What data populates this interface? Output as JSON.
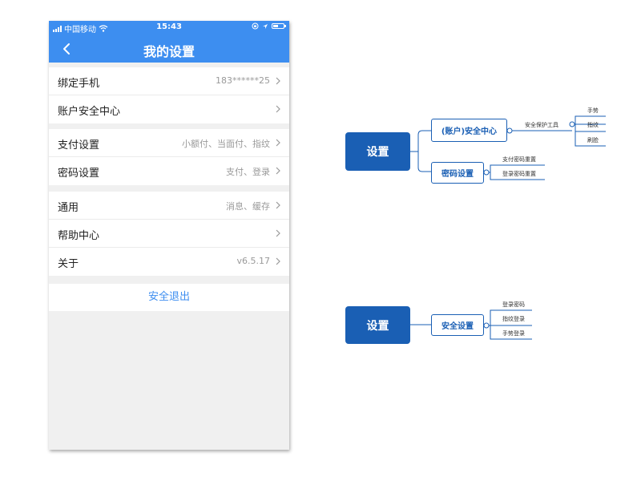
{
  "status_bar": {
    "carrier": "中国移动",
    "time": "15:43"
  },
  "nav": {
    "title": "我的设置"
  },
  "groups": [
    {
      "items": [
        {
          "label": "绑定手机",
          "value": "183******25"
        },
        {
          "label": "账户安全中心",
          "value": ""
        }
      ]
    },
    {
      "items": [
        {
          "label": "支付设置",
          "value": "小额付、当面付、指纹"
        },
        {
          "label": "密码设置",
          "value": "支付、登录"
        }
      ]
    },
    {
      "items": [
        {
          "label": "通用",
          "value": "消息、缓存"
        },
        {
          "label": "帮助中心",
          "value": ""
        },
        {
          "label": "关于",
          "value": "v6.5.17"
        }
      ]
    }
  ],
  "logout_label": "安全退出",
  "mindmap_top": {
    "root": "设置",
    "branches": [
      {
        "label": "(账户)安全中心",
        "sub": "安全保护工具",
        "leaves": [
          "手势",
          "指纹",
          "刷脸"
        ]
      },
      {
        "label": "密码设置",
        "leaves": [
          "支付密码重置",
          "登录密码重置"
        ]
      }
    ]
  },
  "mindmap_bottom": {
    "root": "设置",
    "branch": "安全设置",
    "leaves": [
      "登录密码",
      "指纹登录",
      "手势登录"
    ]
  },
  "colors": {
    "primary": "#3d8ef0",
    "map_dark": "#1a5fb4"
  }
}
